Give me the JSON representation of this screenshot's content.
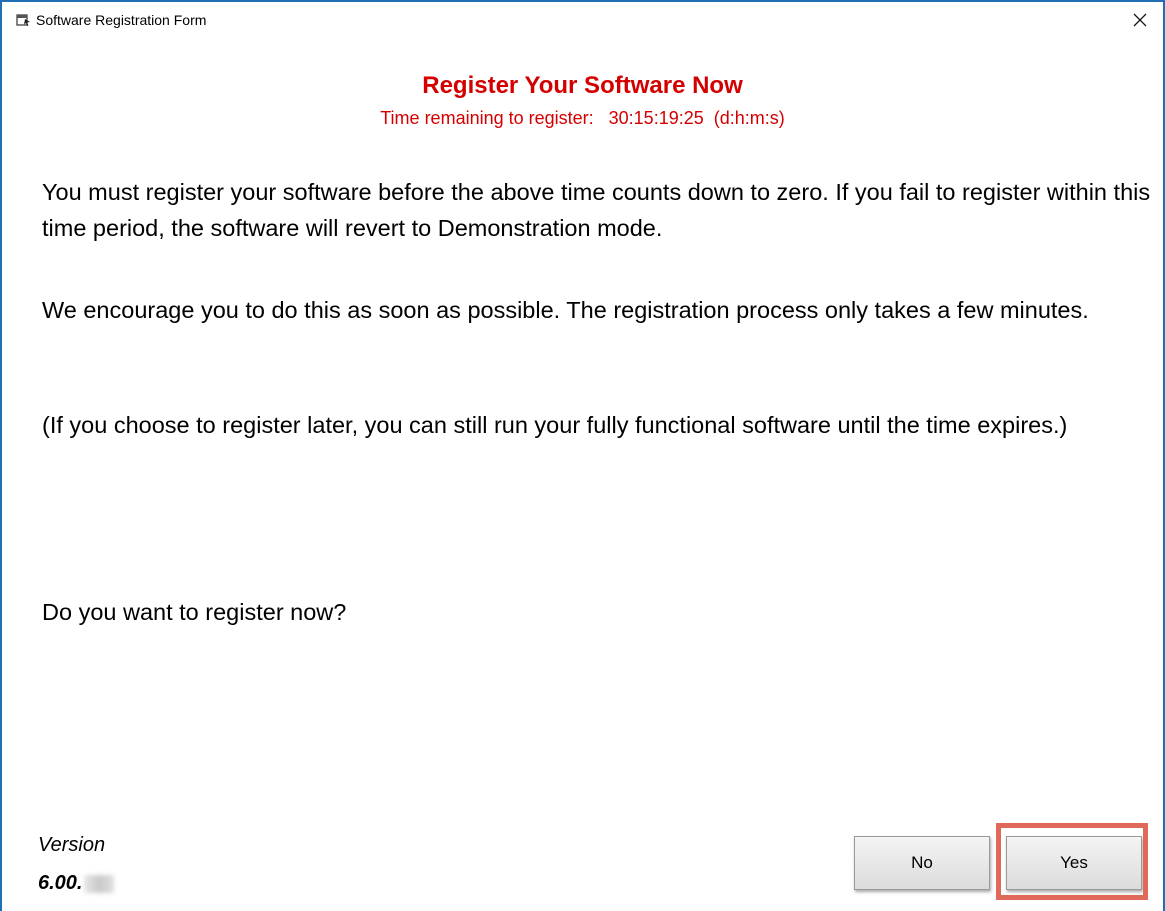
{
  "window": {
    "title": "Software Registration Form",
    "close_glyph": "✕"
  },
  "heading": "Register Your Software Now",
  "timer_text": "Time remaining to register:   30:15:19:25  (d:h:m:s)",
  "paragraphs": {
    "p1": "You must register your software before the above time counts down to zero. If you fail to register within this time period, the software will revert to Demonstration mode.",
    "p2": "We encourage you to do this as soon as possible. The registration process only takes a few minutes.",
    "p3": "(If you choose to register later, you can still run your fully functional software until the time expires.)",
    "question": "Do you want to register now?"
  },
  "version": {
    "label": "Version",
    "value": "6.00."
  },
  "buttons": {
    "no_label": "No",
    "yes_label": "Yes"
  },
  "colors": {
    "accent_red": "#d40000",
    "window_border": "#1f6fb5",
    "highlight": "#e06a5a"
  },
  "icons": {
    "title_icon": "form-icon",
    "close_icon": "close-icon"
  }
}
